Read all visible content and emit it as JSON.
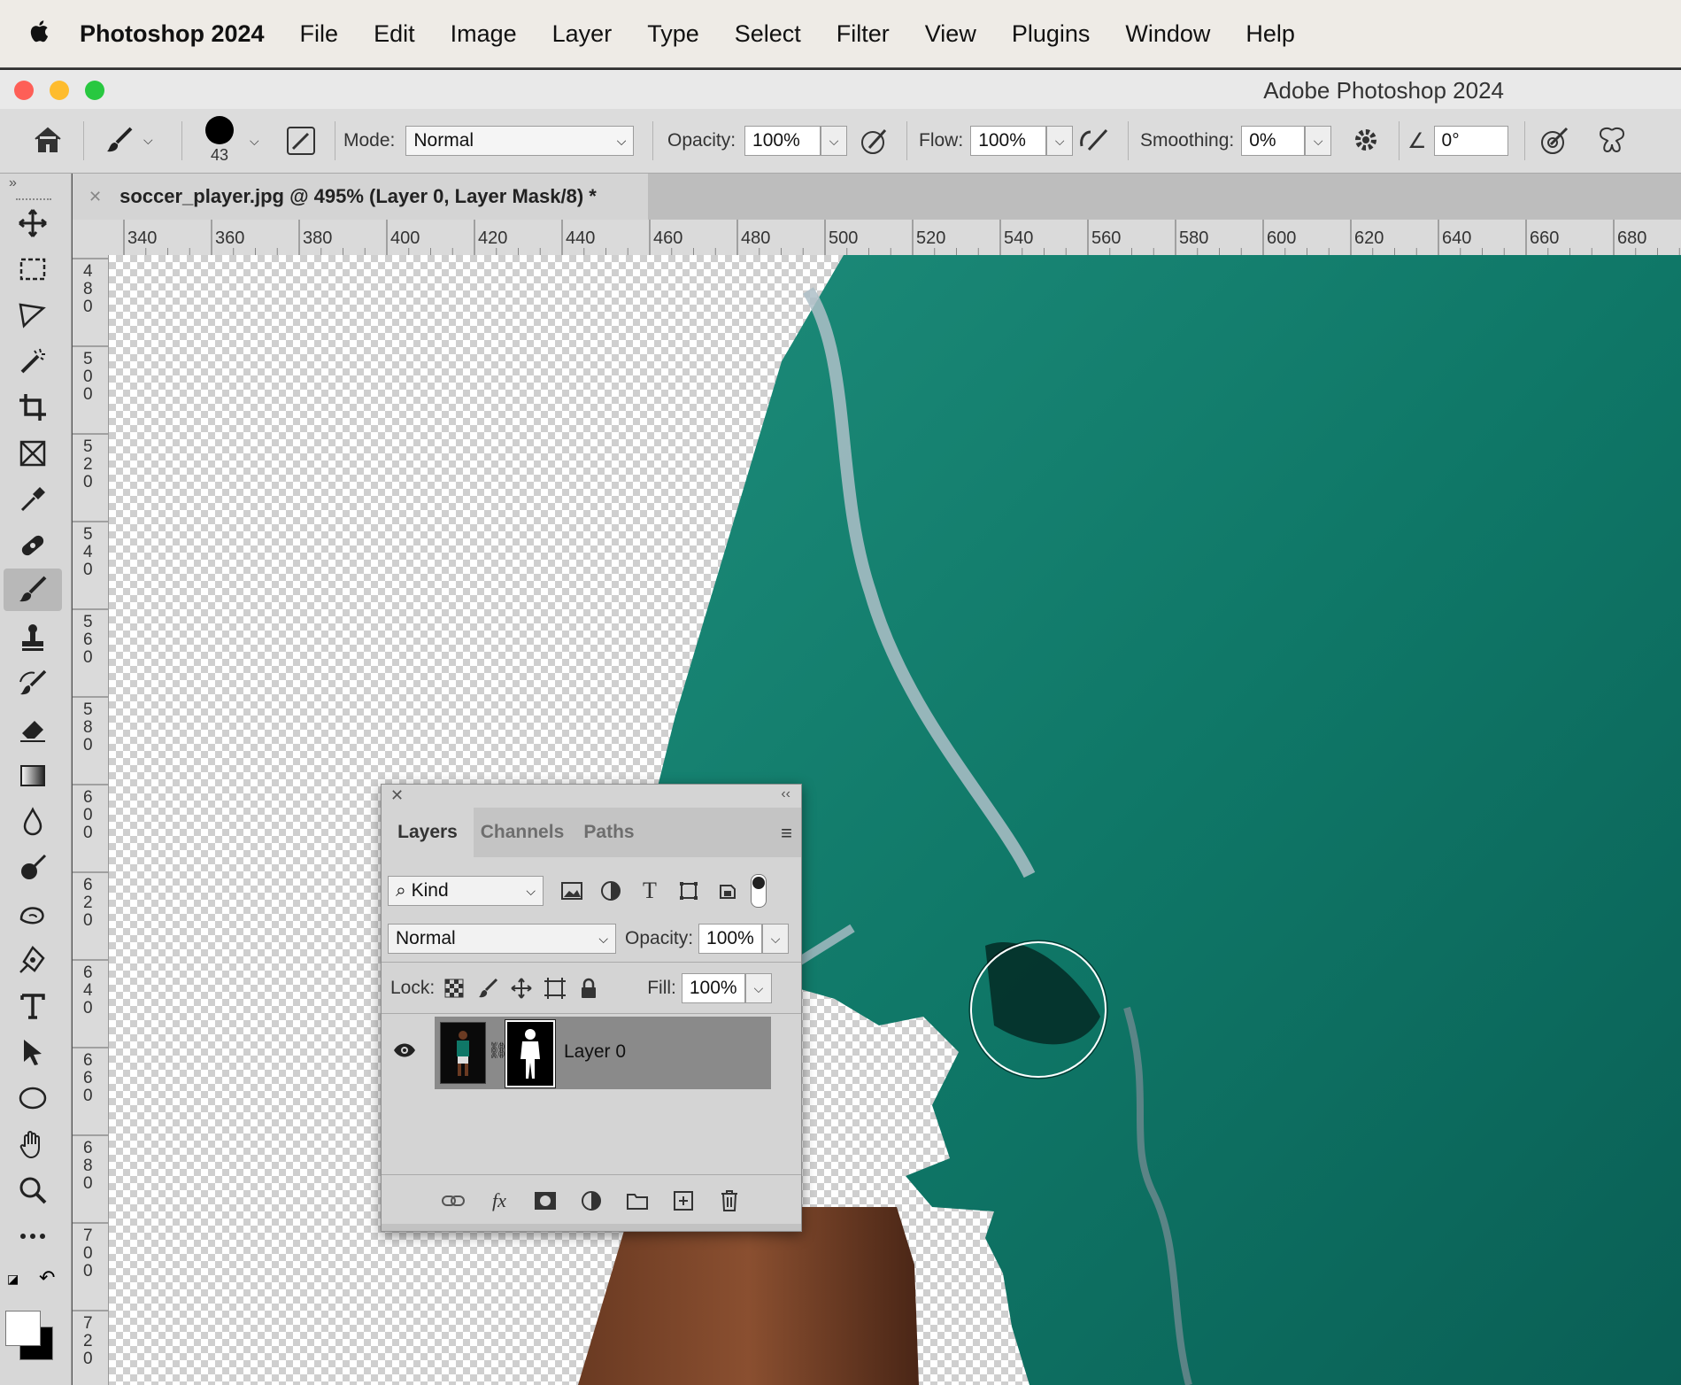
{
  "menubar": {
    "app_name": "Photoshop 2024",
    "items": [
      "File",
      "Edit",
      "Image",
      "Layer",
      "Type",
      "Select",
      "Filter",
      "View",
      "Plugins",
      "Window",
      "Help"
    ]
  },
  "window": {
    "title": "Adobe Photoshop 2024",
    "traffic_colors": [
      "#fe5f57",
      "#febc2e",
      "#28c840"
    ]
  },
  "options": {
    "brush_size": "43",
    "mode_label": "Mode:",
    "mode_value": "Normal",
    "opacity_label": "Opacity:",
    "opacity_value": "100%",
    "flow_label": "Flow:",
    "flow_value": "100%",
    "smoothing_label": "Smoothing:",
    "smoothing_value": "0%",
    "angle_value": "0°"
  },
  "document": {
    "tab_title": "soccer_player.jpg @ 495% (Layer 0, Layer Mask/8) *",
    "zoom_percent": 495
  },
  "rulers": {
    "horizontal": [
      "340",
      "360",
      "380",
      "400",
      "420",
      "440",
      "460",
      "480",
      "500",
      "520",
      "540",
      "560",
      "580",
      "600",
      "620",
      "640",
      "660",
      "680"
    ],
    "vertical": [
      "480",
      "500",
      "520",
      "540",
      "560",
      "580",
      "600",
      "620",
      "640",
      "660",
      "680",
      "700",
      "720"
    ]
  },
  "tools": [
    "move-icon",
    "marquee-icon",
    "lasso-icon",
    "magic-wand-icon",
    "crop-icon",
    "frame-icon",
    "eyedropper-icon",
    "healing-brush-icon",
    "brush-icon",
    "clone-stamp-icon",
    "history-brush-icon",
    "eraser-icon",
    "gradient-icon",
    "blur-icon",
    "dodge-icon",
    "smudge-icon",
    "pen-icon",
    "type-icon",
    "path-selection-icon",
    "ellipse-icon",
    "hand-icon",
    "zoom-icon",
    "more-tools-icon"
  ],
  "colors": {
    "foreground": "#ffffff",
    "background": "#000000",
    "jersey": "#0e7a6a",
    "brush_cursor": "#ffffff"
  },
  "layers_panel": {
    "tabs": [
      "Layers",
      "Channels",
      "Paths"
    ],
    "active_tab": "Layers",
    "filter_label": "Kind",
    "blend_mode": "Normal",
    "opacity_label": "Opacity:",
    "opacity_value": "100%",
    "lock_label": "Lock:",
    "fill_label": "Fill:",
    "fill_value": "100%",
    "layers": [
      {
        "name": "Layer 0",
        "visible": true,
        "has_mask": true
      }
    ]
  }
}
